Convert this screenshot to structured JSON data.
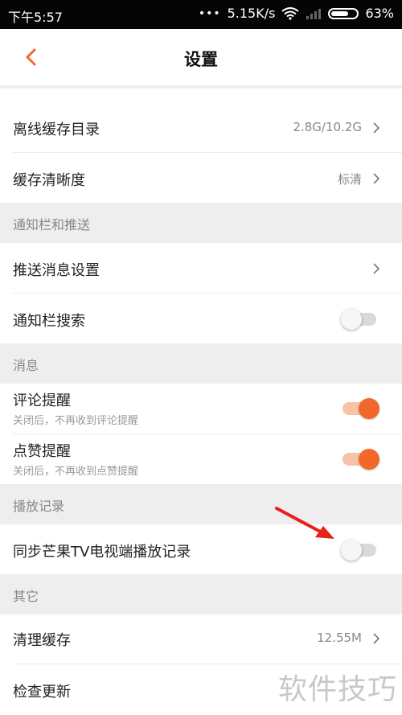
{
  "status_bar": {
    "time": "下午5:57",
    "network_speed": "5.15K/s",
    "battery": "63%",
    "battery_level": 0.63,
    "dots": "•••",
    "wifi_icon": "wifi-icon",
    "signal_icon": "signal-icon"
  },
  "header": {
    "title": "设置",
    "back_icon": "back-chevron-icon",
    "accent": "#f2672a"
  },
  "cache": {
    "offline_dir": {
      "label": "离线缓存目录",
      "value": "2.8G/10.2G"
    },
    "clarity": {
      "label": "缓存清晰度",
      "value": "标清"
    }
  },
  "notification_section": {
    "title": "通知栏和推送",
    "push_settings": {
      "label": "推送消息设置"
    },
    "bar_search": {
      "label": "通知栏搜索",
      "on": false
    }
  },
  "message_section": {
    "title": "消息",
    "comment": {
      "label": "评论提醒",
      "sub": "关闭后，不再收到评论提醒",
      "on": true
    },
    "like": {
      "label": "点赞提醒",
      "sub": "关闭后，不再收到点赞提醒",
      "on": true
    }
  },
  "history_section": {
    "title": "播放记录",
    "sync_tv": {
      "label": "同步芒果TV电视端播放记录",
      "on": false
    }
  },
  "other_section": {
    "title": "其它",
    "clear_cache": {
      "label": "清理缓存",
      "value": "12.55M"
    },
    "check_update": {
      "label": "检查更新"
    }
  },
  "watermark": "软件技巧",
  "annotation_color": "#e8201c"
}
